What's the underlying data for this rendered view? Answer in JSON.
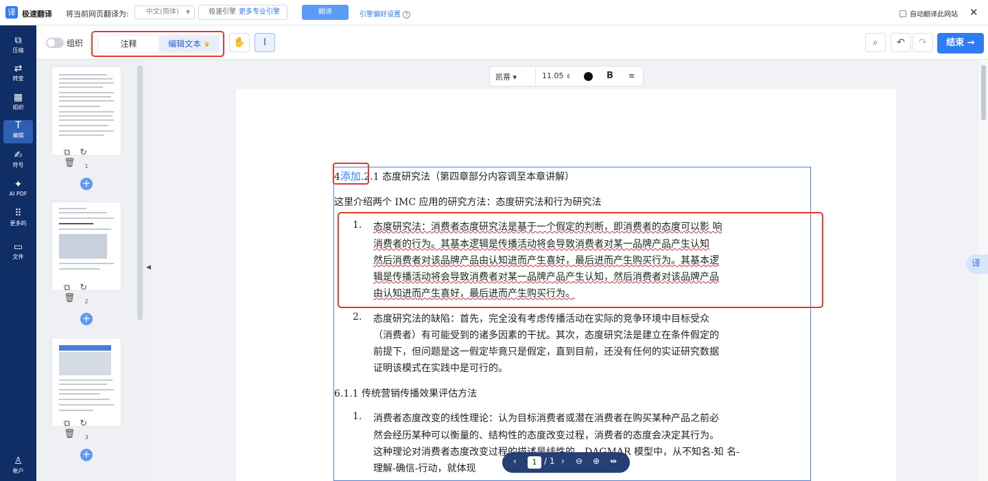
{
  "topbar": {
    "logo_glyph": "译",
    "app_name": "极速翻译",
    "translate_to_label": "将当前网页翻译为:",
    "language_value": "中文(简体)",
    "engine_label": "极速引擎",
    "more_engines_label": "更多专业引擎",
    "translate_button": "翻译",
    "engine_prefs_link": "引擎偏好设置",
    "auto_translate_label": "自动翻译此网站"
  },
  "sidebar": {
    "items": [
      {
        "icon": "compress-icon",
        "label": "压缩"
      },
      {
        "icon": "convert-icon",
        "label": "转变"
      },
      {
        "icon": "organize-icon",
        "label": "组织"
      },
      {
        "icon": "edit-icon",
        "label": "编辑",
        "active": true
      },
      {
        "icon": "sign-icon",
        "label": "符号"
      },
      {
        "icon": "ai-icon",
        "label": "AI PDF"
      },
      {
        "icon": "more-icon",
        "label": "更多的"
      },
      {
        "icon": "file-icon",
        "label": "文件"
      },
      {
        "icon": "account-icon",
        "label": "帐户"
      }
    ]
  },
  "editbar": {
    "organize_toggle_label": "组织",
    "tab_annotate": "注释",
    "tab_edit_text": "编辑文本",
    "end_button": "结束 →"
  },
  "thumbnails": {
    "pages": [
      {
        "num": "1"
      },
      {
        "num": "2"
      },
      {
        "num": "3"
      }
    ]
  },
  "format_toolbar": {
    "font_name": "凯蒂",
    "font_size": "11.05",
    "bold_label": "B"
  },
  "document": {
    "heading_prefix": "4",
    "heading_added": "添加",
    "heading_rest": ".2.1 态度研究法（第四章部分内容调至本章讲解）",
    "intro": "这里介绍两个 IMC 应用的研究方法：态度研究法和行为研究法",
    "item1_num": "1.",
    "item1_lines": [
      " 态度研究法：消费者态度研究法是基于一个假定的判断，即消费者的态度可以影 响",
      "消费者的行为。其基本逻辑是传播活动将会导致消费者对某一品牌产品产生认知",
      "然后消费者对该品牌产品由认知进而产生喜好，最后进而产生购买行为。其基本逻",
      "辑是传播活动将会导致消费者对某一品牌产品产生认知，然后消费者对该品牌产品",
      "由认知进而产生喜好，最后进而产生购买行为。"
    ],
    "item2_num": "2.",
    "item2_lines": [
      "态度研究法的缺陷：首先，完全没有考虑传播活动在实际的竞争环境中目标受众",
      "（消费者）有可能受到的诸多因素的干扰。其次，态度研究法是建立在条件假定的",
      "前提下，但问题是这一假定毕竟只是假定，直到目前，还没有任何的实证研究数据",
      "证明该模式在实践中是可行的。"
    ],
    "section_heading": "6.1.1 传统营销传播效果评估方法",
    "item3_num": "1.",
    "item3_lines": [
      "消费者态度改变的线性理论：认为目标消费者或潜在消费者在购买某种产品之前必",
      "然会经历某种可以衡量的、结构性的态度改变过程，消费者的态度会决定其行为。",
      "这种理论对消费者态度改变过程的描述是线性的，DAGMAR 模型中，从不知名-知 名-",
      "理解-确信-行动，就体现"
    ]
  },
  "pagination": {
    "current_page": "1",
    "total_label": "/ 1"
  },
  "float_translate": "译"
}
